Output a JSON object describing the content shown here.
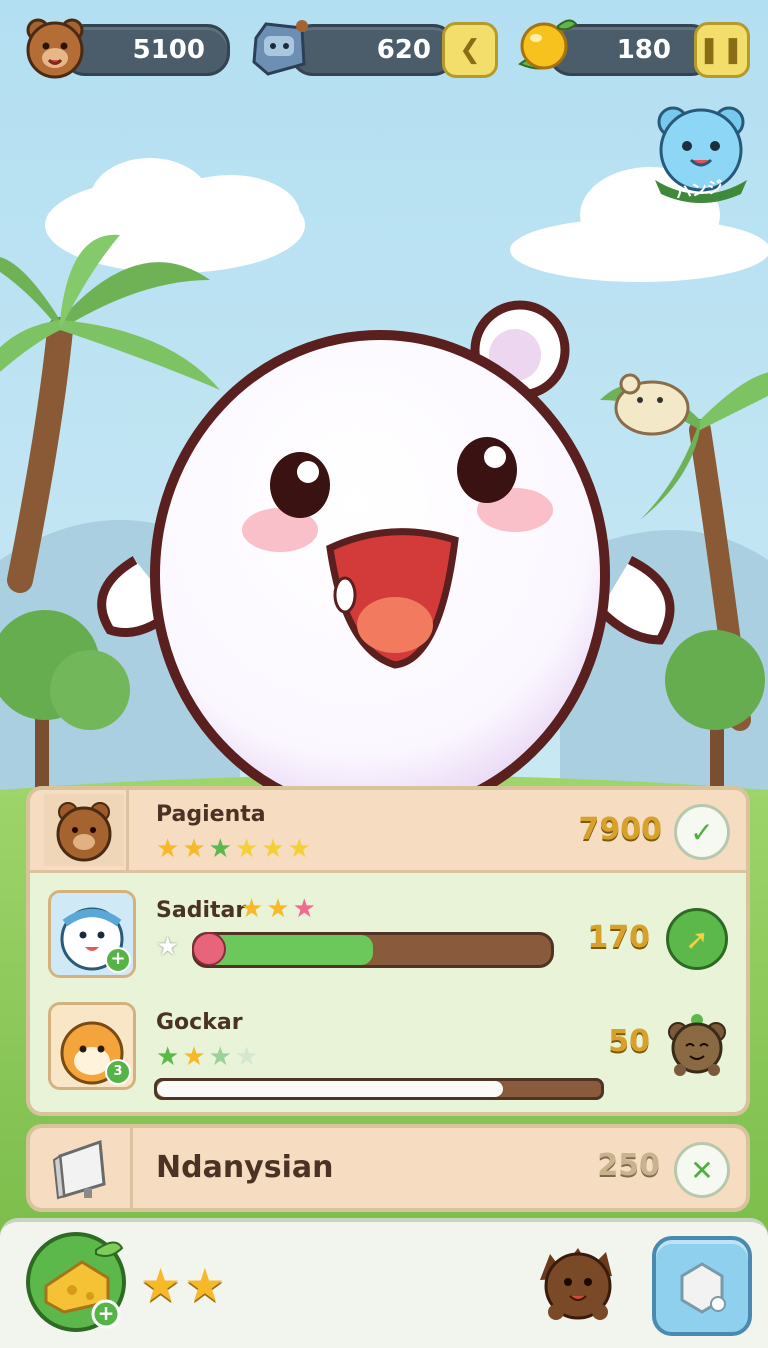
{
  "hud": {
    "coins": "5100",
    "gems": "620",
    "fruit": "180",
    "back_icon": "chevron-left-icon",
    "pause_icon": "pause-icon"
  },
  "badge": {
    "label": "ハンジ"
  },
  "leaderboard": {
    "rows": [
      {
        "name": "Pagienta",
        "score": "7900",
        "stars_filled": 6,
        "stars_total": 6,
        "action_icon": "check-icon"
      },
      {
        "name": "Saditar",
        "score": "170",
        "stars_filled": 3,
        "stars_total": 3,
        "progress": 0.5,
        "action_icon": "leaf-arrow-icon"
      },
      {
        "name": "Gockar",
        "score": "50",
        "stars_filled": 2,
        "stars_total": 4,
        "progress": 0.78,
        "action_icon": "hedgehog-icon"
      }
    ],
    "footer": {
      "name": "Ndanysian",
      "score": "250",
      "action_icon": "close-icon"
    }
  },
  "bottom_bar": {
    "stars": 2,
    "colors": {
      "accent": "#6cc85a",
      "gold": "#f5b92a"
    }
  }
}
